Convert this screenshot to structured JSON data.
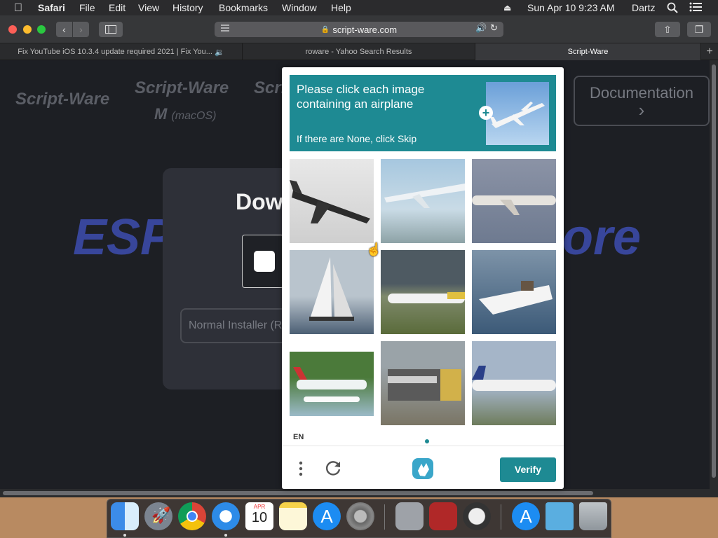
{
  "menubar": {
    "apple": "",
    "app_name": "Safari",
    "items": [
      "File",
      "Edit",
      "View",
      "History",
      "Bookmarks",
      "Window",
      "Help"
    ],
    "clock": "Sun Apr 10  9:23 AM",
    "user": "Dartz"
  },
  "browser": {
    "url": "script-ware.com",
    "tabs": [
      {
        "title": "Fix YouTube iOS 10.3.4 update required 2021 | Fix You..."
      },
      {
        "title": "roware - Yahoo Search Results"
      },
      {
        "title": "Script-Ware"
      }
    ]
  },
  "page": {
    "logo1": "Script-Ware",
    "logo2": "Script-Ware",
    "logo2_sub_m": "M",
    "logo2_sub": "(macOS)",
    "logo3": "Scri",
    "big_left": "ESP",
    "big_right": "ore",
    "card_title": "Dow",
    "normal_installer": "Normal Installer (Re",
    "documentation": "Documentation"
  },
  "captcha": {
    "prompt": "Please click each image containing an airplane",
    "hint": "If there are None, click Skip",
    "language": "EN",
    "verify_label": "Verify",
    "colors": {
      "header": "#1e8a93",
      "verify": "#1e8a93"
    },
    "tiles": [
      {
        "subject": "airplane"
      },
      {
        "subject": "airplane"
      },
      {
        "subject": "airplane"
      },
      {
        "subject": "sailboat"
      },
      {
        "subject": "airplane"
      },
      {
        "subject": "speedboat"
      },
      {
        "subject": "seaplane"
      },
      {
        "subject": "train"
      },
      {
        "subject": "airplane"
      }
    ]
  },
  "dock": {
    "apps": [
      "Finder",
      "Launchpad",
      "Chrome",
      "Safari",
      "Calendar",
      "Notes",
      "App Store",
      "System Preferences",
      "Preview",
      "Photo Booth",
      "Instruments",
      "App Store Downloads",
      "Downloads Folder",
      "Trash"
    ],
    "calendar_month": "APR",
    "calendar_day": "10"
  }
}
